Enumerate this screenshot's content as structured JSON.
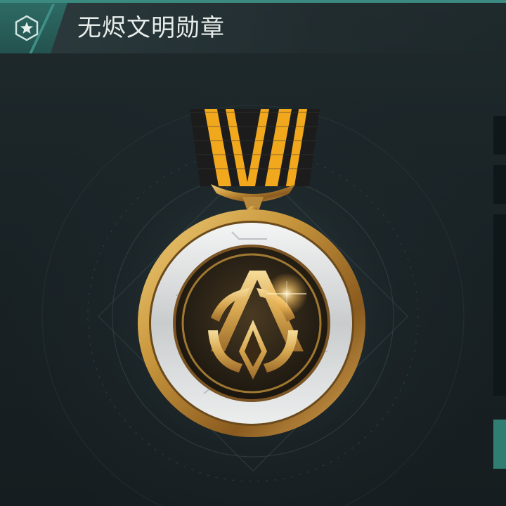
{
  "header": {
    "title": "无烬文明勋章",
    "icon": "star-badge-icon"
  },
  "medal": {
    "name_icon": "civilization-emblem-icon",
    "ribbon_colors": [
      "#1c1c1c",
      "#f2a81d"
    ],
    "rim_color": "#c9973d",
    "inner_ring_color": "#d8dadb"
  },
  "side_panels": {
    "accent_color": "#2f7d73"
  },
  "theme": {
    "accent": "#3b8a80",
    "background": "#1b2225"
  }
}
